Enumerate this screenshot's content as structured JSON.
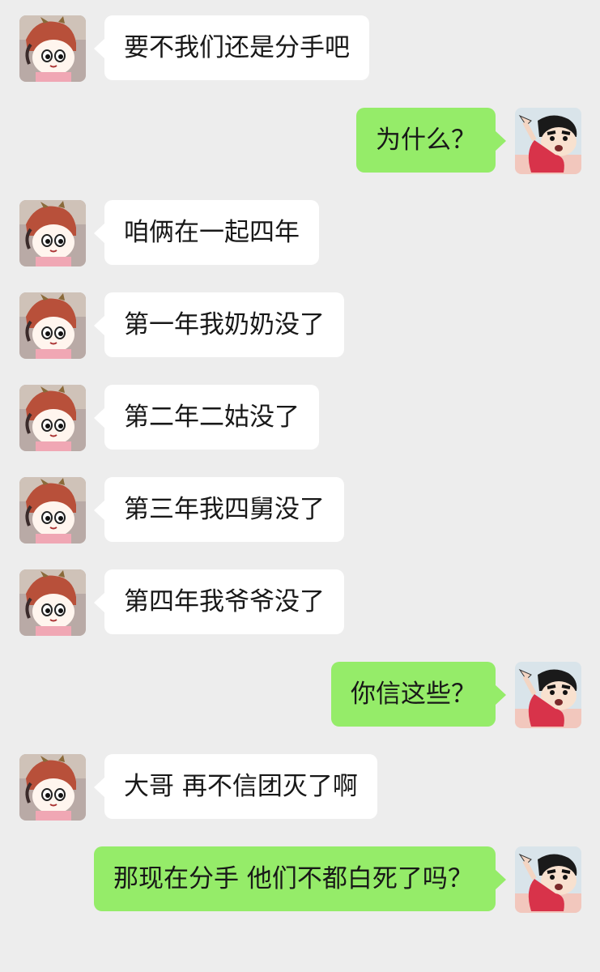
{
  "avatars": {
    "left": "girl-avatar-icon",
    "right": "boy-avatar-icon"
  },
  "colors": {
    "background": "#ededed",
    "incoming_bubble": "#ffffff",
    "outgoing_bubble": "#95ec69",
    "text": "#181818"
  },
  "messages": [
    {
      "side": "left",
      "text": "要不我们还是分手吧"
    },
    {
      "side": "right",
      "text": "为什么？"
    },
    {
      "side": "left",
      "text": "咱俩在一起四年"
    },
    {
      "side": "left",
      "text": "第一年我奶奶没了"
    },
    {
      "side": "left",
      "text": "第二年二姑没了"
    },
    {
      "side": "left",
      "text": "第三年我四舅没了"
    },
    {
      "side": "left",
      "text": "第四年我爷爷没了"
    },
    {
      "side": "right",
      "text": "你信这些？"
    },
    {
      "side": "left",
      "text": "大哥 再不信团灭了啊"
    },
    {
      "side": "right",
      "text": "那现在分手 他们不都白死了吗？"
    }
  ]
}
